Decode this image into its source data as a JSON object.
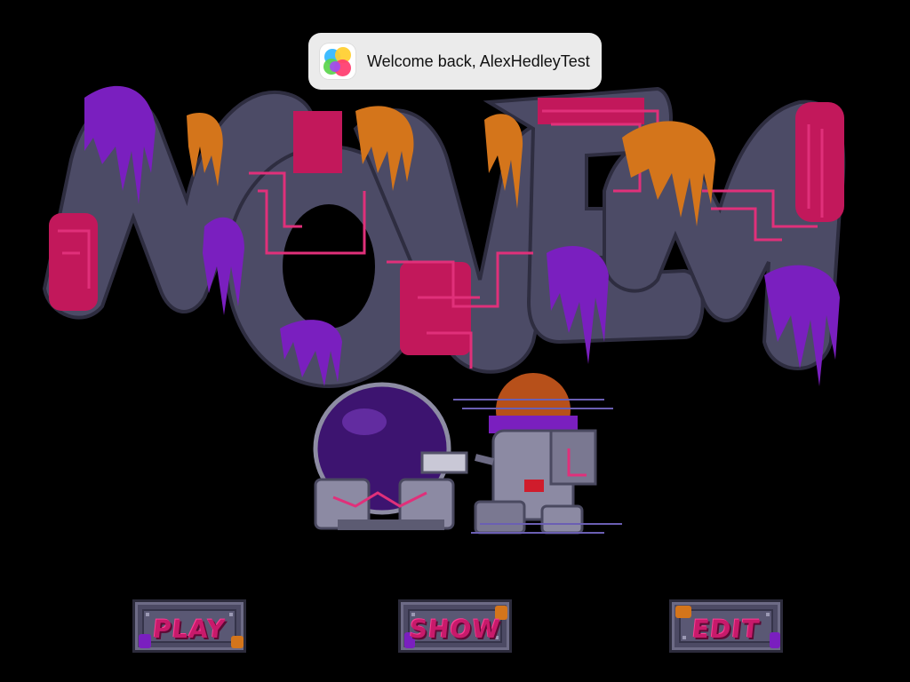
{
  "banner": {
    "message": "Welcome back, AlexHedleyTest",
    "icon": "game-center-icon"
  },
  "title": {
    "logo_text": "MOVEM"
  },
  "menu": {
    "play_label": "PLAY",
    "show_label": "SHOW",
    "edit_label": "EDIT"
  },
  "colors": {
    "background": "#000000",
    "stone": "#4c4b66",
    "magenta": "#c2185b",
    "orange": "#d4751b",
    "purple": "#7a1fbf",
    "banner_bg": "#ebebeb"
  }
}
